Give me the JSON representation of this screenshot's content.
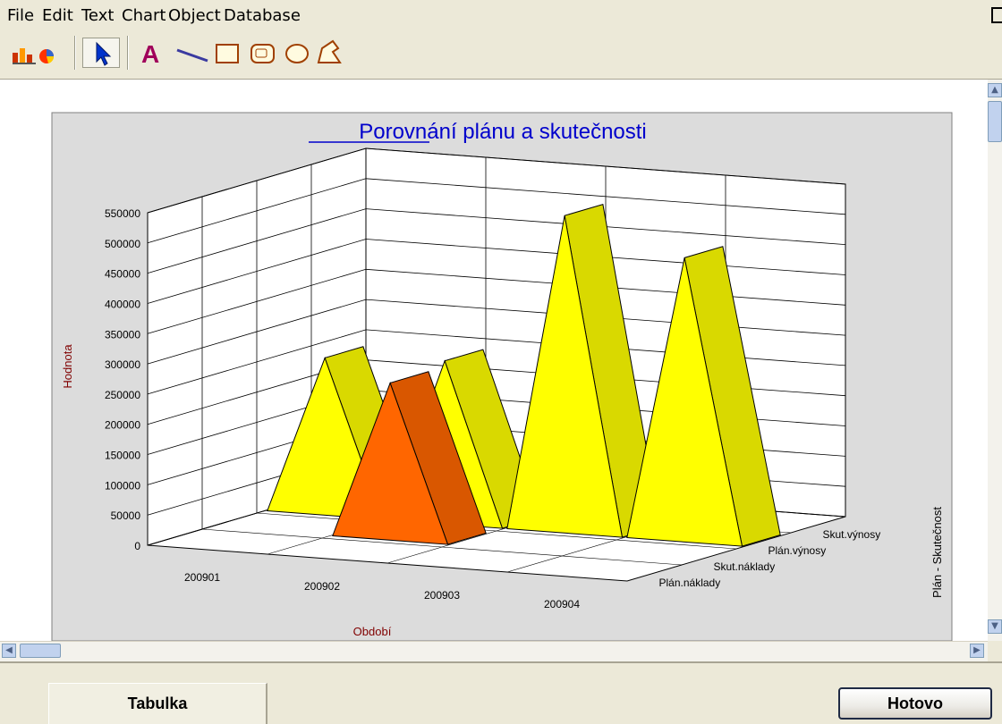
{
  "menu": {
    "items": [
      {
        "label": "File"
      },
      {
        "label": "Edit"
      },
      {
        "label": "Text"
      },
      {
        "label": "Chart"
      },
      {
        "label": "Object"
      },
      {
        "label": "Database"
      }
    ]
  },
  "toolbar": {
    "tools": [
      {
        "icon": "chart-icon"
      },
      {
        "icon": "pointer-icon",
        "selected": true
      },
      {
        "icon": "text-icon",
        "glyph": "A"
      },
      {
        "icon": "line-icon"
      },
      {
        "icon": "rectangle-icon"
      },
      {
        "icon": "rounded-rectangle-icon"
      },
      {
        "icon": "ellipse-icon"
      },
      {
        "icon": "polygon-icon"
      }
    ]
  },
  "colors": {
    "title": "#0000cc",
    "axis_label": "#800000",
    "series_plan_vynosy": "#ffff00",
    "series_skut_naklady": "#ff6600",
    "plot_background": "#dcdcdc"
  },
  "chart_data": {
    "type": "3d-pyramid-bar",
    "title": "Porovnání plánu a skutečnosti",
    "xlabel": "Období",
    "ylabel": "Hodnota",
    "zlabel": "Plán - Skutečnost",
    "categories": [
      "200901",
      "200902",
      "200903",
      "200904"
    ],
    "ylim": [
      0,
      550000
    ],
    "yticks": [
      "0",
      "50000",
      "100000",
      "150000",
      "200000",
      "250000",
      "300000",
      "350000",
      "400000",
      "450000",
      "500000",
      "550000"
    ],
    "depth_labels": [
      "Plán.náklady",
      "Skut.náklady",
      "Plán.výnosy",
      "Skut.výnosy"
    ],
    "series": [
      {
        "name": "Plán.náklady",
        "values": [
          0,
          0,
          0,
          0
        ]
      },
      {
        "name": "Skut.náklady",
        "values": [
          0,
          260000,
          0,
          0
        ]
      },
      {
        "name": "Plán.výnosy",
        "values": [
          260000,
          270000,
          525000,
          470000
        ]
      },
      {
        "name": "Skut.výnosy",
        "values": [
          0,
          0,
          0,
          0
        ]
      }
    ]
  },
  "footer": {
    "tab_label": "Tabulka",
    "done_label": "Hotovo"
  }
}
